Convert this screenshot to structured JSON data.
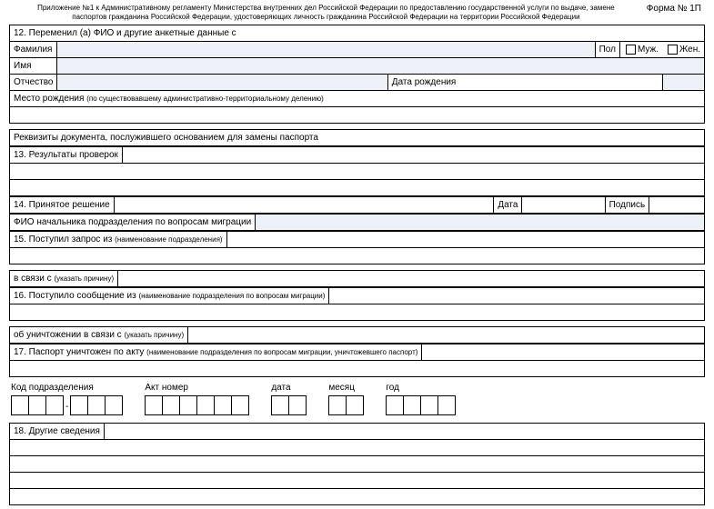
{
  "header": {
    "line1": "Приложение №1 к Административному регламенту Министерства внутренних дел Российской Федерации по предоставлению государственной услуги по выдаче, замене",
    "line2": "паспортов гражданина Российской Федерации, удостоверяющих личность гражданина Российской Федерации на территории Российской Федерации",
    "form_no": "Форма № 1П"
  },
  "s12": {
    "title": "12. Переменил (а) ФИО и другие анкетные данные с",
    "surname": "Фамилия",
    "name": "Имя",
    "patronymic": "Отчество",
    "sex": "Пол",
    "male": "Муж.",
    "female": "Жен.",
    "dob": "Дата рождения",
    "birthplace": "Место рождения",
    "birthplace_note": "(по существовавшему административно-территориальному делению)",
    "doc_req": "Реквизиты документа, послужившего основанием для замены паспорта"
  },
  "s13": {
    "title": "13. Результаты проверок"
  },
  "s14": {
    "title": "14. Принятое решение",
    "date": "Дата",
    "sign": "Подпись",
    "chief": "ФИО начальника подразделения по вопросам миграции"
  },
  "s15": {
    "title": "15. Поступил запрос из",
    "note": "(наименование подразделения)",
    "reason": "в связи с",
    "reason_note": "(указать причину)"
  },
  "s16": {
    "title": "16. Поступило сообщение из",
    "note": "(наименование подразделения по вопросам миграции)",
    "destroy": "об уничтожении в связи с",
    "destroy_note": "(указать причину)"
  },
  "s17": {
    "title": "17. Паспорт уничтожен по акту",
    "note": "(наименование подразделения по вопросам миграции, уничтожевшего паспорт)"
  },
  "codes": {
    "dept": "Код подразделения",
    "act": "Акт номер",
    "date": "дата",
    "month": "месяц",
    "year": "год"
  },
  "s18": {
    "title": "18. Другие сведения"
  }
}
